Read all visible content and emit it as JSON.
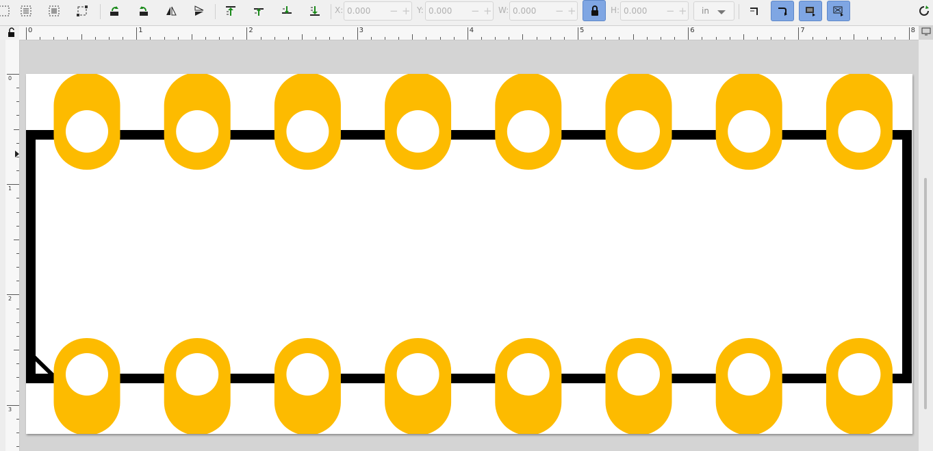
{
  "toolbar": {
    "buttons": [
      {
        "name": "select-all-icon"
      },
      {
        "name": "select-all-layers-icon"
      },
      {
        "name": "deselect-icon"
      },
      {
        "name": "bounding-box-icon"
      },
      {
        "name": "rotate-ccw-icon"
      },
      {
        "name": "rotate-cw-icon"
      },
      {
        "name": "flip-horizontal-icon"
      },
      {
        "name": "flip-vertical-icon"
      },
      {
        "name": "raise-to-top-icon"
      },
      {
        "name": "raise-icon"
      },
      {
        "name": "lower-icon"
      },
      {
        "name": "lower-to-bottom-icon"
      }
    ],
    "x": {
      "label": "X:",
      "value": "0.000"
    },
    "y": {
      "label": "Y:",
      "value": "0.000"
    },
    "w": {
      "label": "W:",
      "value": "0.000"
    },
    "h": {
      "label": "H:",
      "value": "0.000"
    },
    "unit": "in",
    "lock_icon": "lock-icon",
    "stepper_minus": "−",
    "stepper_plus": "+",
    "transform_buttons": [
      {
        "name": "scale-stroke-icon",
        "active": false
      },
      {
        "name": "scale-corners-icon",
        "active": true
      },
      {
        "name": "move-gradients-icon",
        "active": true
      },
      {
        "name": "move-patterns-icon",
        "active": true
      }
    ],
    "right_icon": "snap-toggle-icon"
  },
  "ruler": {
    "h_labels": [
      "0",
      "1",
      "2",
      "3",
      "4",
      "5",
      "6",
      "7",
      "8"
    ],
    "v_labels": [
      "0",
      "1",
      "2",
      "3"
    ]
  },
  "colors": {
    "pad": "#fdbb00",
    "trace": "#000000",
    "page": "#ffffff",
    "desk": "#d4d4d4"
  },
  "drawing": {
    "pads_per_row": 8,
    "rows": [
      "top",
      "bottom"
    ]
  }
}
